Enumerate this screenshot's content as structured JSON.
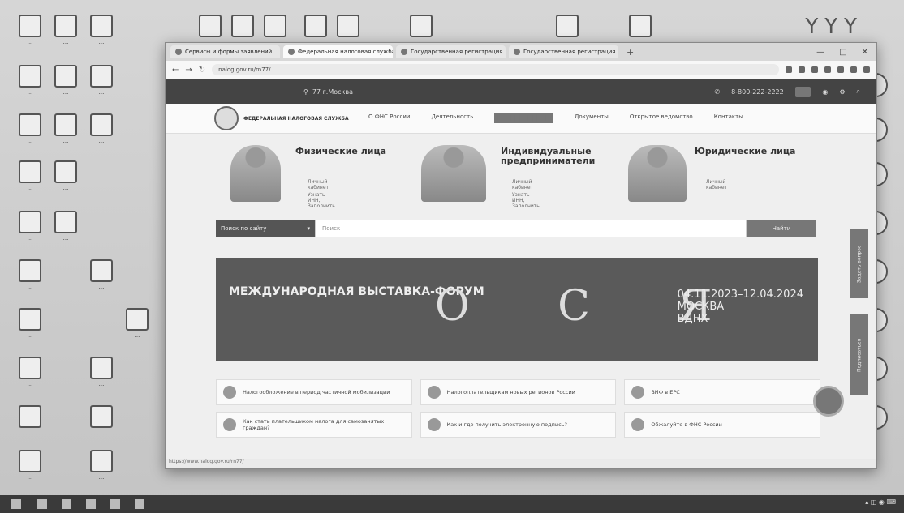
{
  "browser": {
    "tabs": [
      {
        "label": "Сервисы и формы заявлений"
      },
      {
        "label": "Федеральная налоговая служба"
      },
      {
        "label": "Государственная регистрация"
      },
      {
        "label": "Государственная регистрация ЮЛ"
      }
    ],
    "url": "nalog.gov.ru/rn77/"
  },
  "site": {
    "city": "77 г.Москва",
    "phone": "8-800-222-2222",
    "logo_text": "ФЕДЕРАЛЬНАЯ НАЛОГОВАЯ СЛУЖБА",
    "nav": [
      "О ФНС России",
      "Деятельность",
      "Документы",
      "Открытое ведомство",
      "Контакты"
    ],
    "categories": [
      {
        "title": "Физические лица",
        "links": [
          "Личный кабинет",
          "Узнать ИНН, Заполнить"
        ]
      },
      {
        "title": "Индивидуальные предприниматели",
        "links": [
          "Личный кабинет",
          "Узнать ИНН, Заполнить"
        ]
      },
      {
        "title": "Юридические лица",
        "links": [
          "Личный кабинет"
        ]
      }
    ],
    "search": {
      "select_label": "Поиск по сайту",
      "placeholder": "Поиск",
      "button_label": "Найти"
    },
    "banner": {
      "title": "МЕЖДУНАРОДНАЯ ВЫСТАВКА-ФОРУМ",
      "letters": "О С Я",
      "dates": "04.11.2023–12.04.2024",
      "city": "МОСКВА",
      "venue": "ВДНХ"
    },
    "side_buttons": [
      "Задать вопрос",
      "Подписаться"
    ],
    "cards": [
      "Налогообложение в период частичной мобилизации",
      "Налогоплательщикам новых регионов России",
      "ВИФ в ЕРС",
      "Как стать плательщиком налога для самозанятых граждан?",
      "Как и где получить электронную подпись?",
      "Обжалуйте в ФНС России"
    ],
    "status_url": "https://www.nalog.gov.ru/rn77/"
  }
}
